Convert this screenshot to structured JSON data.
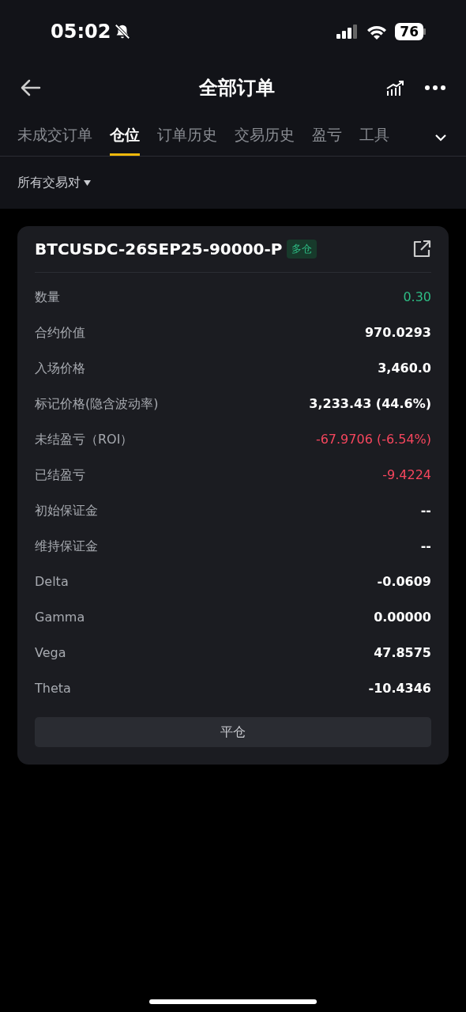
{
  "status_bar": {
    "time": "05:02",
    "battery": "76"
  },
  "header": {
    "title": "全部订单"
  },
  "tabs": [
    {
      "label": "未成交订单",
      "selected": false
    },
    {
      "label": "仓位",
      "selected": true
    },
    {
      "label": "订单历史",
      "selected": false
    },
    {
      "label": "交易历史",
      "selected": false
    },
    {
      "label": "盈亏",
      "selected": false
    },
    {
      "label": "工具",
      "selected": false
    }
  ],
  "filter": {
    "label": "所有交易对"
  },
  "position": {
    "symbol": "BTCUSDC-26SEP25-90000-P",
    "side_badge": "多仓",
    "rows": [
      {
        "label": "数量",
        "value": "0.30",
        "kind": "gain"
      },
      {
        "label": "合约价值",
        "value": "970.0293",
        "kind": "plain"
      },
      {
        "label": "入场价格",
        "value": "3,460.0",
        "kind": "plain"
      },
      {
        "label": "标记价格(隐含波动率)",
        "value": "3,233.43 (44.6%)",
        "kind": "plain"
      },
      {
        "label": "未结盈亏（ROI）",
        "value": "-67.9706 (-6.54%)",
        "kind": "loss"
      },
      {
        "label": "已结盈亏",
        "value": "-9.4224",
        "kind": "loss"
      },
      {
        "label": "初始保证金",
        "value": "--",
        "kind": "plain"
      },
      {
        "label": "维持保证金",
        "value": "--",
        "kind": "plain"
      },
      {
        "label": "Delta",
        "value": "-0.0609",
        "kind": "plain"
      },
      {
        "label": "Gamma",
        "value": "0.00000",
        "kind": "plain"
      },
      {
        "label": "Vega",
        "value": "47.8575",
        "kind": "plain"
      },
      {
        "label": "Theta",
        "value": "-10.4346",
        "kind": "plain"
      }
    ],
    "close_button": "平仓"
  }
}
